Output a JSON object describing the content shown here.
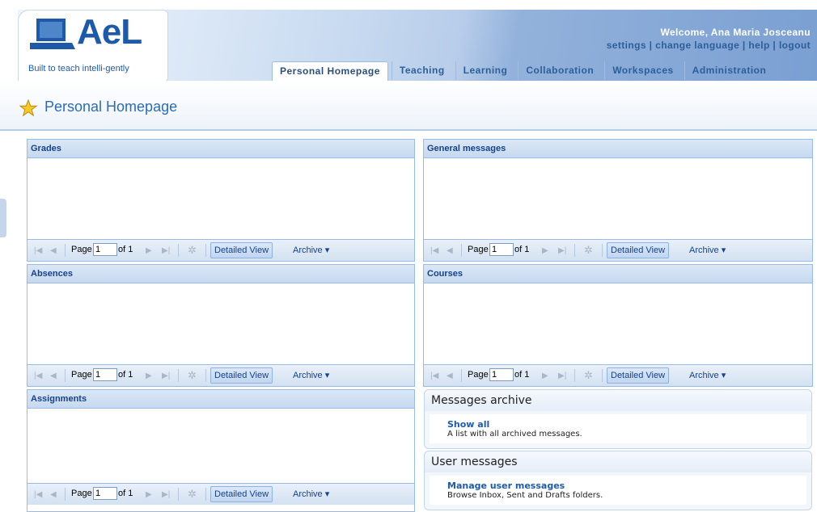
{
  "header": {
    "logo_text": "AeL",
    "tagline": "Built to teach intelli-gently",
    "welcome": "Welcome, Ana Maria Josceanu",
    "links": [
      "settings",
      "change language",
      "help",
      "logout"
    ],
    "link_separator": " | "
  },
  "tabs": [
    {
      "label": "Personal Homepage",
      "active": true
    },
    {
      "label": "Teaching",
      "active": false
    },
    {
      "label": "Learning",
      "active": false
    },
    {
      "label": "Collaboration",
      "active": false
    },
    {
      "label": "Workspaces",
      "active": false
    },
    {
      "label": "Administration",
      "active": false
    }
  ],
  "page": {
    "title": "Personal Homepage",
    "icon": "star-icon"
  },
  "pager": {
    "page_label": "Page",
    "page_value": "1",
    "of_label": "of 1",
    "detailed_view": "Detailed View",
    "archive": "Archive ▾"
  },
  "panels": {
    "grades": {
      "title": "Grades"
    },
    "general_messages": {
      "title": "General messages"
    },
    "absences": {
      "title": "Absences"
    },
    "courses": {
      "title": "Courses"
    },
    "assignments": {
      "title": "Assignments"
    }
  },
  "messages_archive": {
    "title": "Messages archive",
    "link": "Show all",
    "desc": "A list with all archived messages."
  },
  "user_messages": {
    "title": "User messages",
    "link": "Manage user messages",
    "desc": "Browse Inbox, Sent and Drafts folders."
  },
  "colors": {
    "accent": "#1f5aa8",
    "panel_border": "#99bbe8",
    "panel_title": "#15428b"
  }
}
